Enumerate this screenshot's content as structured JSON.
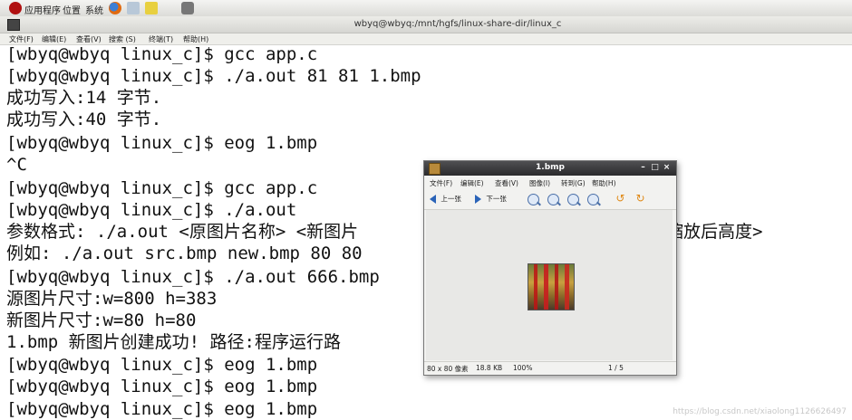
{
  "top_panel": {
    "menus": [
      "应用程序",
      "位置",
      "系统"
    ]
  },
  "window": {
    "title": "wbyq@wbyq:/mnt/hgfs/linux-share-dir/linux_c"
  },
  "terminal_menu": [
    "文件(F)",
    "编辑(E)",
    "查看(V)",
    "搜索 (S)",
    "终端(T)",
    "帮助(H)"
  ],
  "terminal": {
    "lines": [
      "[wbyq@wbyq linux_c]$ gcc app.c",
      "[wbyq@wbyq linux_c]$ ./a.out 81 81 1.bmp",
      "成功写入:14 字节.",
      "成功写入:40 字节.",
      "[wbyq@wbyq linux_c]$ eog 1.bmp",
      "^C",
      "[wbyq@wbyq linux_c]$ gcc app.c",
      "[wbyq@wbyq linux_c]$ ./a.out",
      "参数格式: ./a.out <原图片名称> <新图片",
      "例如: ./a.out src.bmp new.bmp 80 80",
      "[wbyq@wbyq linux_c]$ ./a.out 666.bmp",
      "源图片尺寸:w=800 h=383",
      "新图片尺寸:w=80 h=80",
      "1.bmp 新图片创建成功! 路径:程序运行路",
      "[wbyq@wbyq linux_c]$ eog 1.bmp",
      "[wbyq@wbyq linux_c]$ eog 1.bmp",
      "[wbyq@wbyq linux_c]$ eog 1.bmp"
    ],
    "line9_tail": "缩放后高度>"
  },
  "viewer": {
    "title": "1.bmp",
    "menu": [
      "文件(F)",
      "编辑(E)",
      "查看(V)",
      "图像(I)",
      "转到(G)",
      "帮助(H)"
    ],
    "prev_label": "上一张",
    "next_label": "下一张",
    "status": {
      "dimensions": "80 x 80 像素",
      "size": "18.8 KB",
      "zoom": "100%",
      "position": "1 / 5"
    }
  },
  "watermark": "https://blog.csdn.net/xiaolong1126626497"
}
